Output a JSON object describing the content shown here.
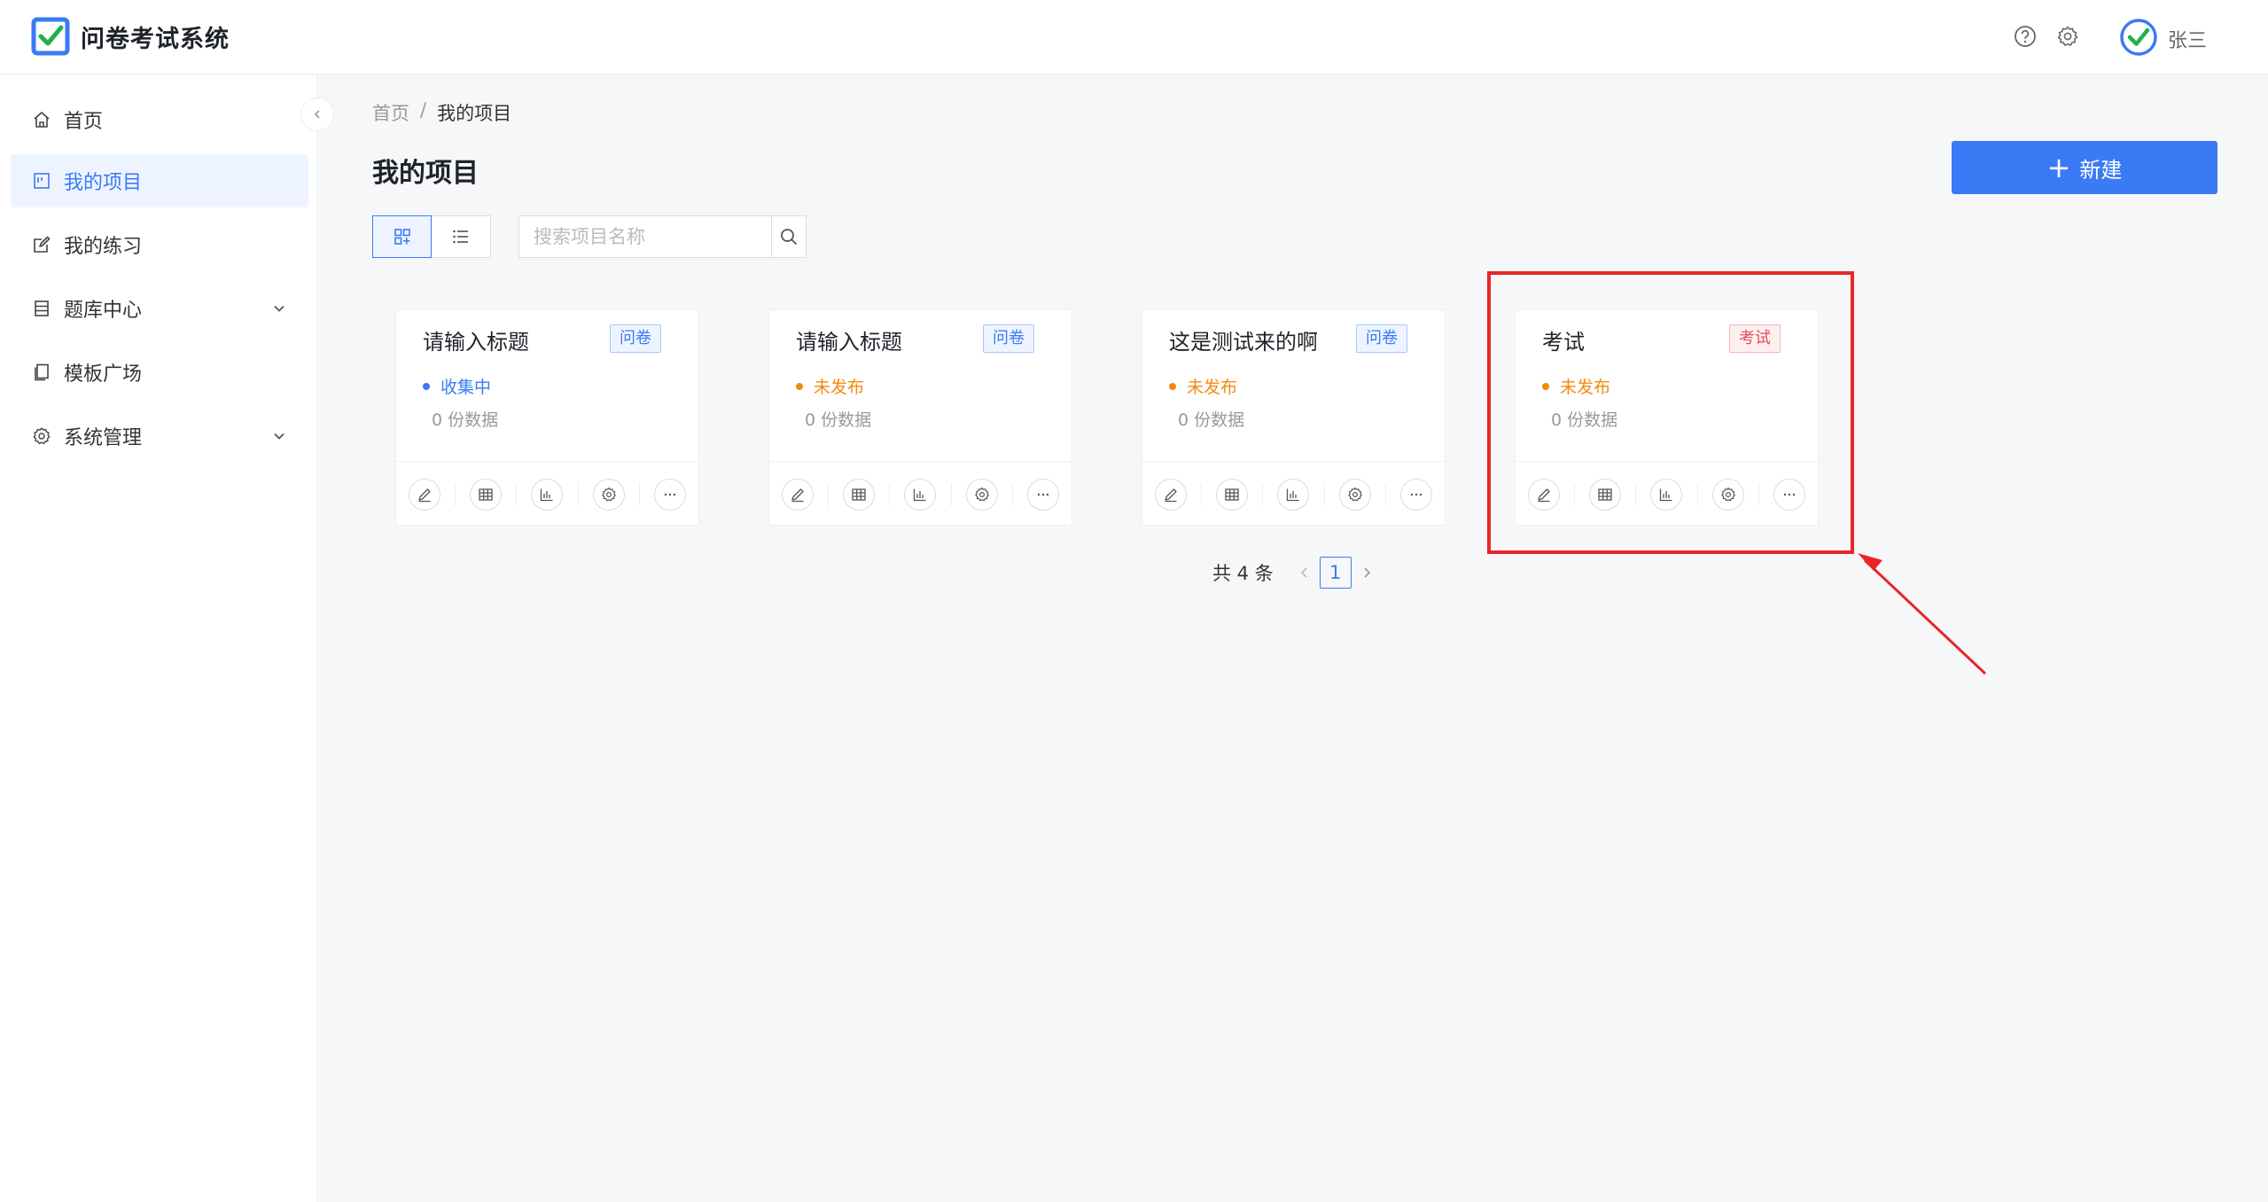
{
  "app": {
    "title": "问卷考试系统"
  },
  "header": {
    "username": "张三"
  },
  "sidebar": {
    "items": [
      {
        "label": "首页",
        "icon": "home-icon"
      },
      {
        "label": "我的项目",
        "icon": "project-icon",
        "active": true
      },
      {
        "label": "我的练习",
        "icon": "edit-icon"
      },
      {
        "label": "题库中心",
        "icon": "bank-icon",
        "expandable": true
      },
      {
        "label": "模板广场",
        "icon": "template-icon"
      },
      {
        "label": "系统管理",
        "icon": "gear-icon",
        "expandable": true
      }
    ]
  },
  "breadcrumb": {
    "home": "首页",
    "sep": "/",
    "current": "我的项目"
  },
  "page": {
    "title": "我的项目",
    "new_label": "新建"
  },
  "search": {
    "placeholder": "搜索项目名称"
  },
  "cards": [
    {
      "title": "请输入标题",
      "tag": "问卷",
      "status": "收集中",
      "count": "0  份数据"
    },
    {
      "title": "请输入标题",
      "tag": "问卷",
      "status": "未发布",
      "count": "0  份数据"
    },
    {
      "title": "这是测试来的啊",
      "tag": "问卷",
      "status": "未发布",
      "count": "0  份数据"
    },
    {
      "title": "考试",
      "tag": "考试",
      "status": "未发布",
      "count": "0  份数据"
    }
  ],
  "pagination": {
    "total": "共 4 条",
    "current": "1"
  },
  "colors": {
    "primary": "#3a7af5",
    "collecting": "#3a7af5",
    "unpublished": "#f28a0f",
    "exam_tag": "#e34d59",
    "annotation": "#e8262a"
  }
}
